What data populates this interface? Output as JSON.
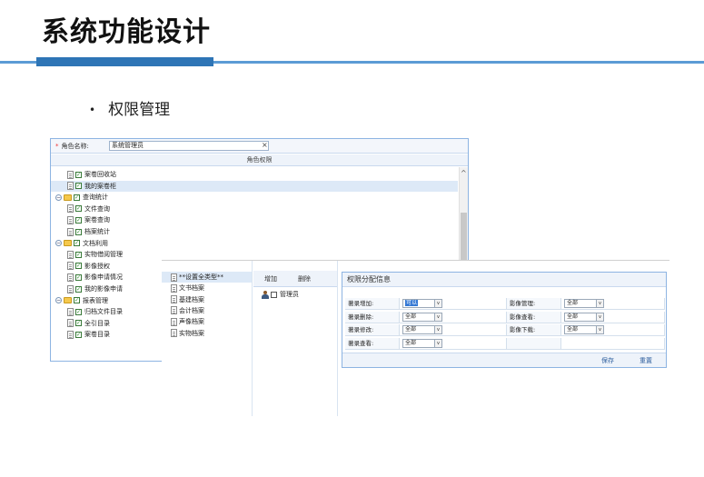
{
  "slide": {
    "title": "系统功能设计",
    "bullet": "权限管理",
    "bullet_marker": "•"
  },
  "colors": {
    "accent": "#2e75b6",
    "line": "#5b9bd5",
    "panel_border": "#8db4e2",
    "selected_row": "#dde9f7"
  },
  "role_window": {
    "role_label": "角色名称:",
    "required_mark": "*",
    "role_value": "系统管理员",
    "clear_glyph": "×",
    "perm_header": "角色权限",
    "scroll_up_glyph": "^",
    "tree": [
      {
        "label": "案卷回收站",
        "icon": "doc-icon",
        "checked": true
      },
      {
        "label": "我的案卷柜",
        "icon": "doc-icon",
        "checked": true,
        "selected": true
      },
      {
        "label": "查询统计",
        "icon": "folder-icon",
        "checked": true,
        "toggle": "−"
      },
      {
        "label": "文件查询",
        "icon": "doc-icon",
        "checked": true
      },
      {
        "label": "案卷查询",
        "icon": "doc-icon",
        "checked": true
      },
      {
        "label": "档案统计",
        "icon": "doc-icon",
        "checked": true
      },
      {
        "label": "文档利用",
        "icon": "folder-icon",
        "checked": true,
        "toggle": "−"
      },
      {
        "label": "实物借阅管理",
        "icon": "doc-icon",
        "checked": true
      },
      {
        "label": "影像授权",
        "icon": "doc-icon",
        "checked": true
      },
      {
        "label": "影像申请情况",
        "icon": "doc-icon",
        "checked": true
      },
      {
        "label": "我的影像申请",
        "icon": "doc-icon",
        "checked": true
      },
      {
        "label": "报表管理",
        "icon": "folder-icon",
        "checked": true,
        "toggle": "−"
      },
      {
        "label": "归档文件目录",
        "icon": "doc-icon",
        "checked": true
      },
      {
        "label": "全引目录",
        "icon": "doc-icon",
        "checked": true
      },
      {
        "label": "案卷目录",
        "icon": "doc-icon",
        "checked": true
      }
    ]
  },
  "assign_window": {
    "types": [
      {
        "label": "**设置全类型**",
        "selected": true
      },
      {
        "label": "文书档案"
      },
      {
        "label": "基建档案"
      },
      {
        "label": "会计档案"
      },
      {
        "label": "声像档案"
      },
      {
        "label": "实物档案"
      }
    ],
    "add_label": "增加",
    "delete_label": "删除",
    "user_label": "管理员",
    "panel_title": "权限分配信息",
    "rows": [
      {
        "left_label": "著录增加:",
        "left_value": "可以",
        "left_highlight": true,
        "right_label": "影像管理:",
        "right_value": "全部"
      },
      {
        "left_label": "著录删除:",
        "left_value": "全部",
        "right_label": "影像查看:",
        "right_value": "全部"
      },
      {
        "left_label": "著录修改:",
        "left_value": "全部",
        "right_label": "影像下载:",
        "right_value": "全部"
      },
      {
        "left_label": "著录查看:",
        "left_value": "全部",
        "right_label": "",
        "right_value": ""
      }
    ],
    "dropdown_glyph": "v",
    "save_label": "保存",
    "reset_label": "重置"
  }
}
